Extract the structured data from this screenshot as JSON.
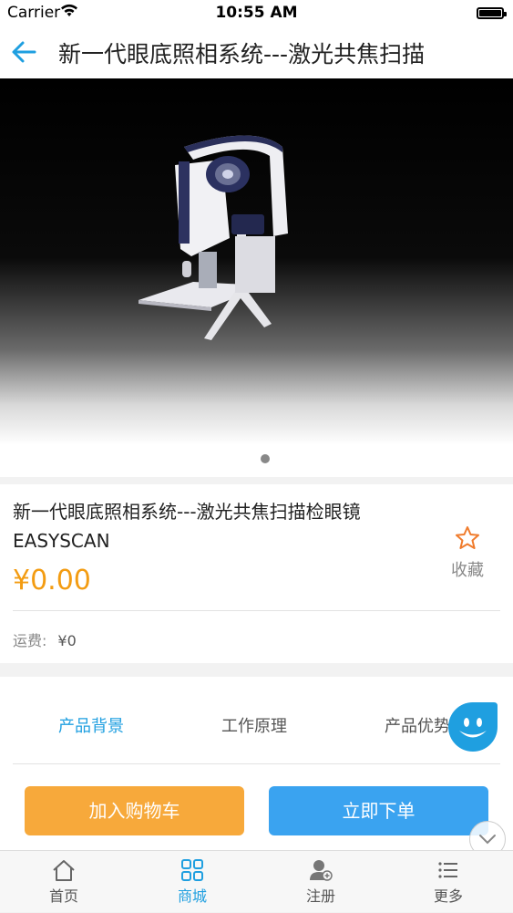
{
  "status_bar": {
    "carrier": "Carrier",
    "time": "10:55 AM"
  },
  "nav": {
    "title": "新一代眼底照相系统---激光共焦扫描"
  },
  "banner": {
    "image": "laser-confocal-fundus-camera"
  },
  "product": {
    "name": "新一代眼底照相系统---激光共焦扫描检眼镜EASYSCAN",
    "price": "¥0.00",
    "favorite_label": "收藏",
    "shipping_label": "运费:",
    "shipping_value": "¥0"
  },
  "tabs": [
    {
      "label": "产品背景",
      "active": true
    },
    {
      "label": "工作原理",
      "active": false
    },
    {
      "label": "产品优势",
      "active": false
    }
  ],
  "actions": {
    "add_to_cart": "加入购物车",
    "buy_now": "立即下单"
  },
  "tabbar": [
    {
      "label": "首页",
      "icon": "home-icon",
      "active": false
    },
    {
      "label": "商城",
      "icon": "grid-icon",
      "active": true
    },
    {
      "label": "注册",
      "icon": "user-add-icon",
      "active": false
    },
    {
      "label": "更多",
      "icon": "list-icon",
      "active": false
    }
  ],
  "colors": {
    "accent": "#1f9fe0",
    "price": "#f39c12",
    "cart": "#f7a93b",
    "buy": "#3aa3f0"
  }
}
